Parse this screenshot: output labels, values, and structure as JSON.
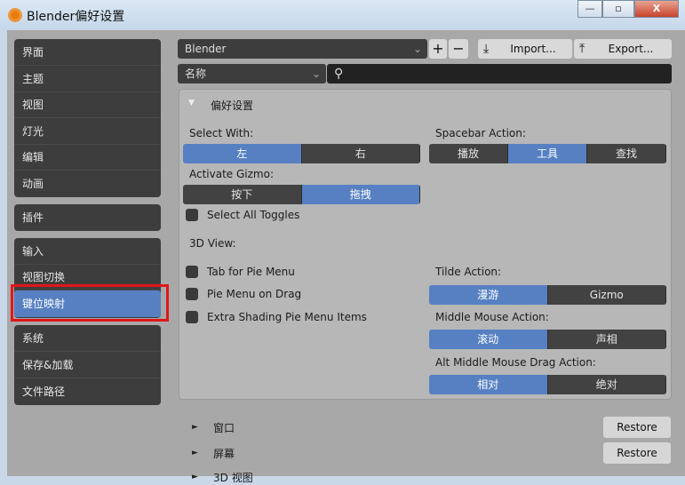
{
  "window": {
    "title": "Blender偏好设置",
    "minimize": "—",
    "maximize": "▫",
    "close": "X"
  },
  "sidebar": {
    "groups": [
      [
        "界面",
        "主题",
        "视图",
        "灯光",
        "编辑",
        "动画"
      ],
      [
        "插件"
      ],
      [
        "输入",
        "视图切换",
        "键位映射"
      ],
      [
        "系统",
        "保存&加载",
        "文件路径"
      ]
    ],
    "selected": "键位映射"
  },
  "toolbar": {
    "preset": "Blender",
    "add": "+",
    "remove": "−",
    "import": "Import...",
    "export": "Export...",
    "filter": "名称",
    "search_placeholder": ""
  },
  "panel": {
    "title": "偏好设置",
    "select_with": {
      "label": "Select With:",
      "options": [
        "左",
        "右"
      ],
      "active": 0
    },
    "activate_gizmo": {
      "label": "Activate Gizmo:",
      "options": [
        "按下",
        "拖拽"
      ],
      "active": 1
    },
    "select_all_toggles": "Select All Toggles",
    "view3d": "3D View:",
    "checks": [
      "Tab for Pie Menu",
      "Pie Menu on Drag",
      "Extra Shading Pie Menu Items"
    ],
    "spacebar": {
      "label": "Spacebar Action:",
      "options": [
        "播放",
        "工具",
        "查找"
      ],
      "active": 1
    },
    "tilde": {
      "label": "Tilde Action:",
      "options": [
        "漫游",
        "Gizmo"
      ],
      "active": 0
    },
    "middle": {
      "label": "Middle Mouse Action:",
      "options": [
        "滚动",
        "声相"
      ],
      "active": 0
    },
    "alt_middle": {
      "label": "Alt Middle Mouse Drag Action:",
      "options": [
        "相对",
        "绝对"
      ],
      "active": 0
    }
  },
  "sections": [
    "窗口",
    "屏幕",
    "3D 视图"
  ],
  "restore": "Restore"
}
